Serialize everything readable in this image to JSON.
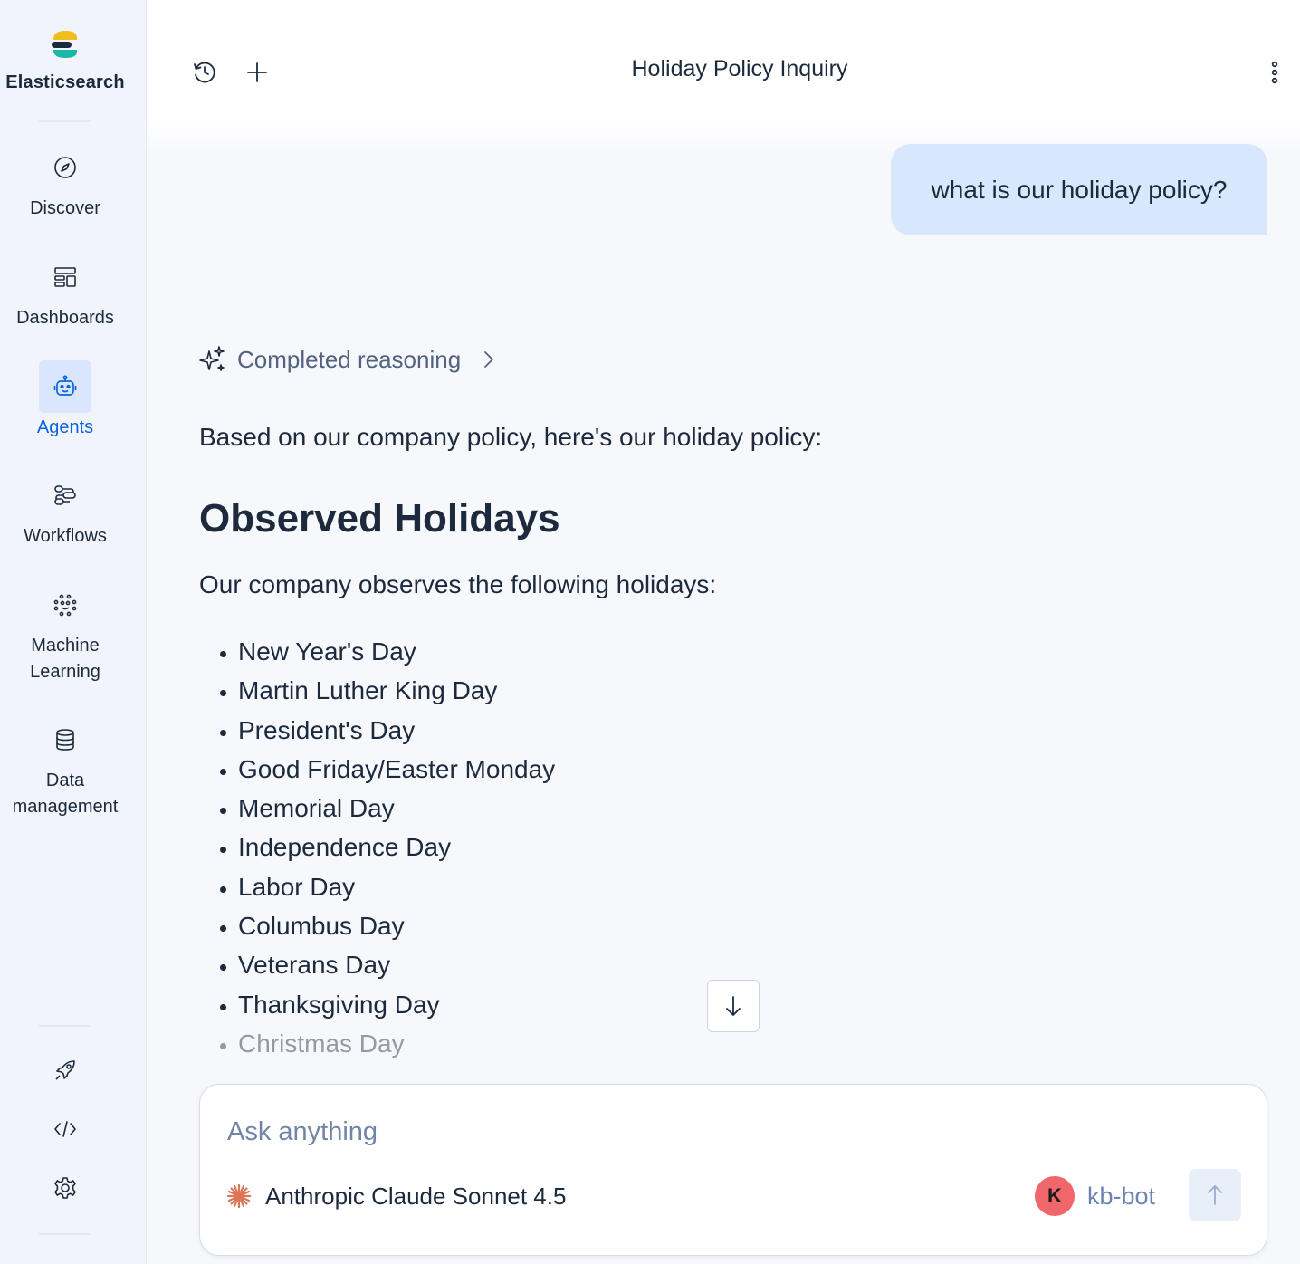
{
  "brand": {
    "name": "Elasticsearch",
    "logo_icon": "elastic-logo"
  },
  "sidebar": {
    "items": [
      {
        "label": "Discover",
        "icon": "compass-icon",
        "active": false
      },
      {
        "label": "Dashboards",
        "icon": "dashboard-icon",
        "active": false
      },
      {
        "label": "Agents",
        "icon": "robot-icon",
        "active": true
      },
      {
        "label": "Workflows",
        "icon": "workflow-icon",
        "active": false
      },
      {
        "label": "Machine Learning",
        "line1": "Machine",
        "line2": "Learning",
        "icon": "machine-learning-icon",
        "active": false
      },
      {
        "label": "Data management",
        "line1": "Data",
        "line2": "management",
        "icon": "database-icon",
        "active": false
      }
    ],
    "bottom_icons": [
      "rocket-icon",
      "code-icon",
      "gear-icon"
    ]
  },
  "header": {
    "title": "Holiday Policy Inquiry",
    "icons": [
      "history-icon",
      "plus-icon",
      "more-vertical-icon"
    ]
  },
  "conversation": {
    "user_message": "what is our holiday policy?",
    "reasoning_label": "Completed reasoning",
    "answer": {
      "lead": "Based on our company policy, here's our holiday policy:",
      "heading": "Observed Holidays",
      "intro": "Our company observes the following holidays:",
      "holidays": [
        "New Year's Day",
        "Martin Luther King Day",
        "President's Day",
        "Good Friday/Easter Monday",
        "Memorial Day",
        "Independence Day",
        "Labor Day",
        "Columbus Day",
        "Veterans Day",
        "Thanksgiving Day",
        "Christmas Day"
      ]
    }
  },
  "composer": {
    "placeholder": "Ask anything",
    "model": "Anthropic Claude Sonnet 4.5",
    "agent_initial": "K",
    "agent_name": "kb-bot"
  },
  "colors": {
    "accent": "#0b64dd",
    "active_nav_bg": "#d9e6fc",
    "user_bubble": "#d9e7fd",
    "avatar": "#f1666a",
    "claude_icon": "#d97757"
  }
}
